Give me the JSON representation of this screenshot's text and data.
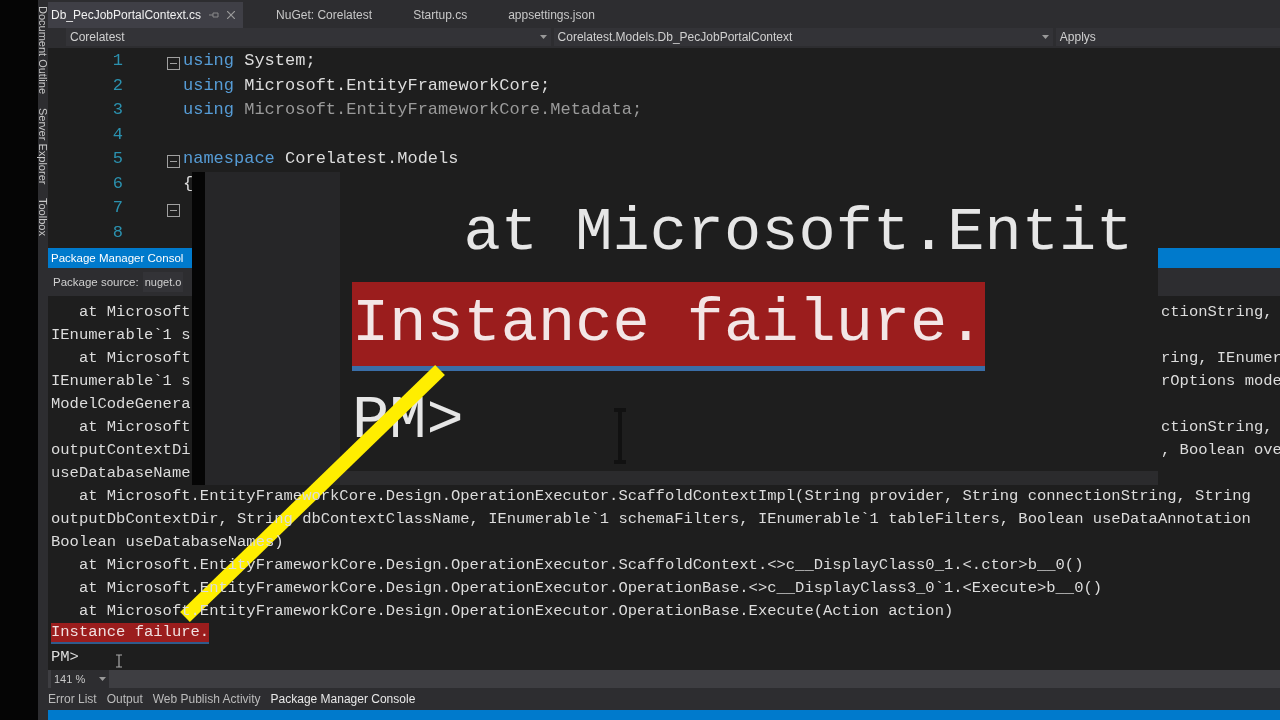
{
  "tool_tabs": [
    {
      "label": "Document Outline"
    },
    {
      "label": "Server Explorer"
    },
    {
      "label": "Toolbox"
    }
  ],
  "editor_tabs": [
    {
      "label": "Db_PecJobPortalContext.cs",
      "selected": true
    },
    {
      "label": "NuGet: Corelatest",
      "selected": false
    },
    {
      "label": "Startup.cs",
      "selected": false
    },
    {
      "label": "appsettings.json",
      "selected": false
    }
  ],
  "nav_bar": {
    "project": "Corelatest",
    "type": "Corelatest.Models.Db_PecJobPortalContext",
    "member": "Applys"
  },
  "code_lines": [
    {
      "number": "1",
      "fold_marker": true,
      "tokens": [
        {
          "kind": "keyword",
          "text": "using"
        },
        {
          "kind": "plain",
          "text": " System;"
        }
      ]
    },
    {
      "number": "2",
      "fold_marker": false,
      "tokens": [
        {
          "kind": "keyword",
          "text": "using"
        },
        {
          "kind": "plain",
          "text": " Microsoft.EntityFrameworkCore;"
        }
      ]
    },
    {
      "number": "3",
      "fold_marker": false,
      "tokens": [
        {
          "kind": "keyword",
          "text": "using"
        },
        {
          "kind": "dim",
          "text": " Microsoft.EntityFrameworkCore.Metadata;"
        }
      ]
    },
    {
      "number": "4",
      "fold_marker": false
    },
    {
      "number": "5",
      "fold_marker": true,
      "tokens": [
        {
          "kind": "keyword",
          "text": "namespace"
        },
        {
          "kind": "plain",
          "text": " Corelatest.Models"
        }
      ]
    },
    {
      "number": "6",
      "fold_marker": false,
      "tokens": [
        {
          "kind": "plain",
          "text": "{"
        }
      ]
    },
    {
      "number": "7",
      "fold_marker": true
    },
    {
      "number": "8",
      "fold_marker": false
    }
  ],
  "console": {
    "title": "Package Manager Consol",
    "source_label": "Package source:",
    "source_value": "nuget.o",
    "lines": [
      {
        "kind": "split",
        "left": "   at Microsoft",
        "right": "ctionString,"
      },
      {
        "kind": "split",
        "left": "IEnumerable`1 s"
      },
      {
        "kind": "split",
        "left": "   at Microsoft",
        "right": "ring, IEnumer"
      },
      {
        "kind": "split",
        "left": "IEnumerable`1 s",
        "right": "rOptions mode"
      },
      {
        "kind": "split",
        "left": "ModelCodeGenera"
      },
      {
        "kind": "split",
        "left": "   at Microsoft",
        "right": "ctionString,"
      },
      {
        "kind": "split",
        "left": "outputContextDi",
        "right": ", Boolean ove"
      },
      {
        "kind": "split",
        "left": "useDatabaseName"
      },
      {
        "kind": "full",
        "text": "   at Microsoft.EntityFrameworkCore.Design.OperationExecutor.ScaffoldContextImpl(String provider, String connectionString, String"
      },
      {
        "kind": "full",
        "text": "outputDbContextDir, String dbContextClassName, IEnumerable`1 schemaFilters, IEnumerable`1 tableFilters, Boolean useDataAnnotation"
      },
      {
        "kind": "full",
        "text": "Boolean useDatabaseNames)"
      },
      {
        "kind": "full",
        "text": "   at Microsoft.EntityFrameworkCore.Design.OperationExecutor.ScaffoldContext.<>c__DisplayClass0_1.<.ctor>b__0()"
      },
      {
        "kind": "full",
        "text": "   at Microsoft.EntityFrameworkCore.Design.OperationExecutor.OperationBase.<>c__DisplayClass3_0`1.<Execute>b__0()"
      },
      {
        "kind": "full",
        "text": "   at Microsoft.EntityFrameworkCore.Design.OperationExecutor.OperationBase.Execute(Action action)"
      },
      {
        "kind": "error",
        "text": "Instance failure."
      },
      {
        "kind": "prompt",
        "text": "PM>"
      }
    ],
    "zoom": "141 %"
  },
  "inset": {
    "lines": [
      {
        "kind": "plain",
        "text": "   at Microsoft.Entit"
      },
      {
        "kind": "error",
        "text": "Instance failure."
      },
      {
        "kind": "prompt",
        "text": "PM>"
      }
    ]
  },
  "bottom_tabs": [
    {
      "label": "Error List",
      "selected": false
    },
    {
      "label": "Output",
      "selected": false
    },
    {
      "label": "Web Publish Activity",
      "selected": false
    },
    {
      "label": "Package Manager Console",
      "selected": true
    }
  ]
}
